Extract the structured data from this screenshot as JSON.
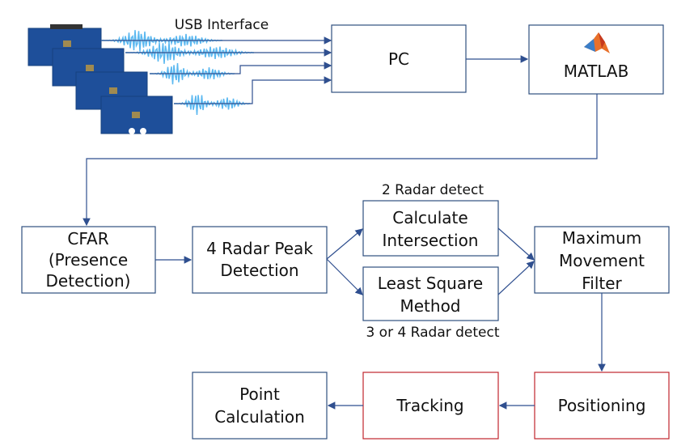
{
  "labels": {
    "usb": "USB Interface",
    "pc": "PC",
    "matlab": "MATLAB",
    "cfar": [
      "CFAR",
      "(Presence",
      "Detection)"
    ],
    "peak": [
      "4 Radar Peak",
      "Detection"
    ],
    "intersection": [
      "Calculate",
      "Intersection"
    ],
    "least_square": [
      "Least Square",
      "Method"
    ],
    "two_radar": "2 Radar detect",
    "three_four_radar": "3 or 4 Radar detect",
    "max_filter": [
      "Maximum",
      "Movement",
      "Filter"
    ],
    "positioning": "Positioning",
    "tracking": "Tracking",
    "point": [
      "Point",
      "Calculation"
    ]
  },
  "colors": {
    "box_border": "#2f4f7f",
    "highlight_border": "#c0262d",
    "arrow": "#2f4f8f",
    "radar_board": "#1e4f9a",
    "signal": "#5bb8f0"
  },
  "icons": {
    "radar_boards": "radar-board-image",
    "matlab": "matlab-logo"
  }
}
